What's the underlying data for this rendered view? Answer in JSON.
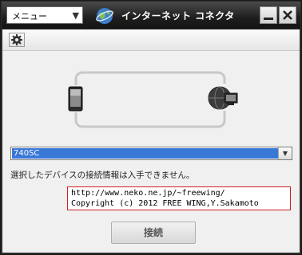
{
  "titlebar": {
    "menu_label": "メニュー",
    "app_title": "インターネット コネクタ"
  },
  "device_select": {
    "selected": "740SC"
  },
  "status_text": "選択したデバイスの接続情報は入手できません。",
  "credit": {
    "url": "http://www.neko.ne.jp/~freewing/",
    "copyright": "Copyright (c) 2012 FREE WING,Y.Sakamoto"
  },
  "connect_button": {
    "label": "接続"
  },
  "colors": {
    "titlebar": "#1e1e1e",
    "select_highlight": "#3a78d8",
    "credit_border": "#d02020"
  },
  "icons": [
    "chevron-down-icon",
    "globe-icon",
    "minimize-icon",
    "close-icon",
    "gear-icon",
    "phone-icon",
    "globe-computer-icon"
  ]
}
